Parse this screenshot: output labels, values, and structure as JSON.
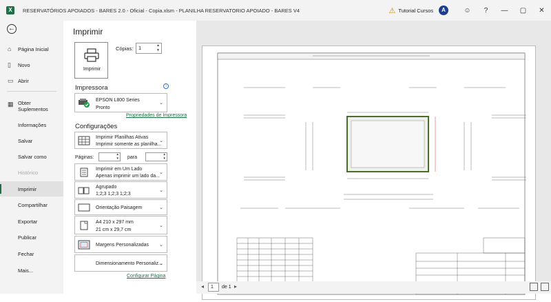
{
  "titlebar": {
    "title": "RESERVATÓRIOS APOIADOS - BARES 2.0 - Oficial - Copia.xlsm  -  PLANILHA RESERVATORIO APOIADO - BARES V4",
    "user": "Tutorial Cursos",
    "help": "?",
    "minimize": "—",
    "restore": "▢",
    "close": "✕",
    "accent": "#1e7145"
  },
  "sidebar": {
    "back": "←",
    "items": [
      {
        "label": "Página Inicial",
        "icon": "home-icon",
        "glyph": "⌂"
      },
      {
        "label": "Novo",
        "icon": "new-file-icon",
        "glyph": "▯"
      },
      {
        "label": "Abrir",
        "icon": "folder-icon",
        "glyph": "▭"
      },
      {
        "label": "Obter",
        "label2": "Suplementos",
        "icon": "grid-icon",
        "glyph": "▦"
      },
      {
        "label": "Informações"
      },
      {
        "label": "Salvar"
      },
      {
        "label": "Salvar como"
      },
      {
        "label": "Histórico"
      },
      {
        "label": "Imprimir"
      },
      {
        "label": "Compartilhar"
      },
      {
        "label": "Exportar"
      },
      {
        "label": "Publicar"
      },
      {
        "label": "Fechar"
      },
      {
        "label": "Mais..."
      }
    ]
  },
  "print": {
    "heading": "Imprimir",
    "print_button": "Imprimir",
    "copies_label": "Cópias:",
    "copies_value": "1",
    "printer_section": "Impressora",
    "printer_name": "EPSON L800 Series",
    "printer_status": "Pronto",
    "printer_properties": "Propriedades de Impressora",
    "settings_section": "Configurações",
    "active_sheets_title": "Imprimir Planilhas Ativas",
    "active_sheets_sub": "Imprimir somente as planilha...",
    "pages_label": "Páginas:",
    "to_label": "para",
    "sided_title": "Imprimir em Um Lado",
    "sided_sub": "Apenas imprimir um lado da...",
    "collated_title": "Agrupado",
    "collated_sub": "1;2;3   1;2;3   1;2;3",
    "orientation": "Orientação Paisagem",
    "paper_title": "A4 210 x 297 mm",
    "paper_sub": "21 cm x 29,7 cm",
    "margins": "Margens Personalizadas",
    "scaling": "Dimensionamento Personaliz...",
    "page_setup": "Configurar Página"
  },
  "preview": {
    "current_page": "1",
    "of_label": "de 1"
  }
}
